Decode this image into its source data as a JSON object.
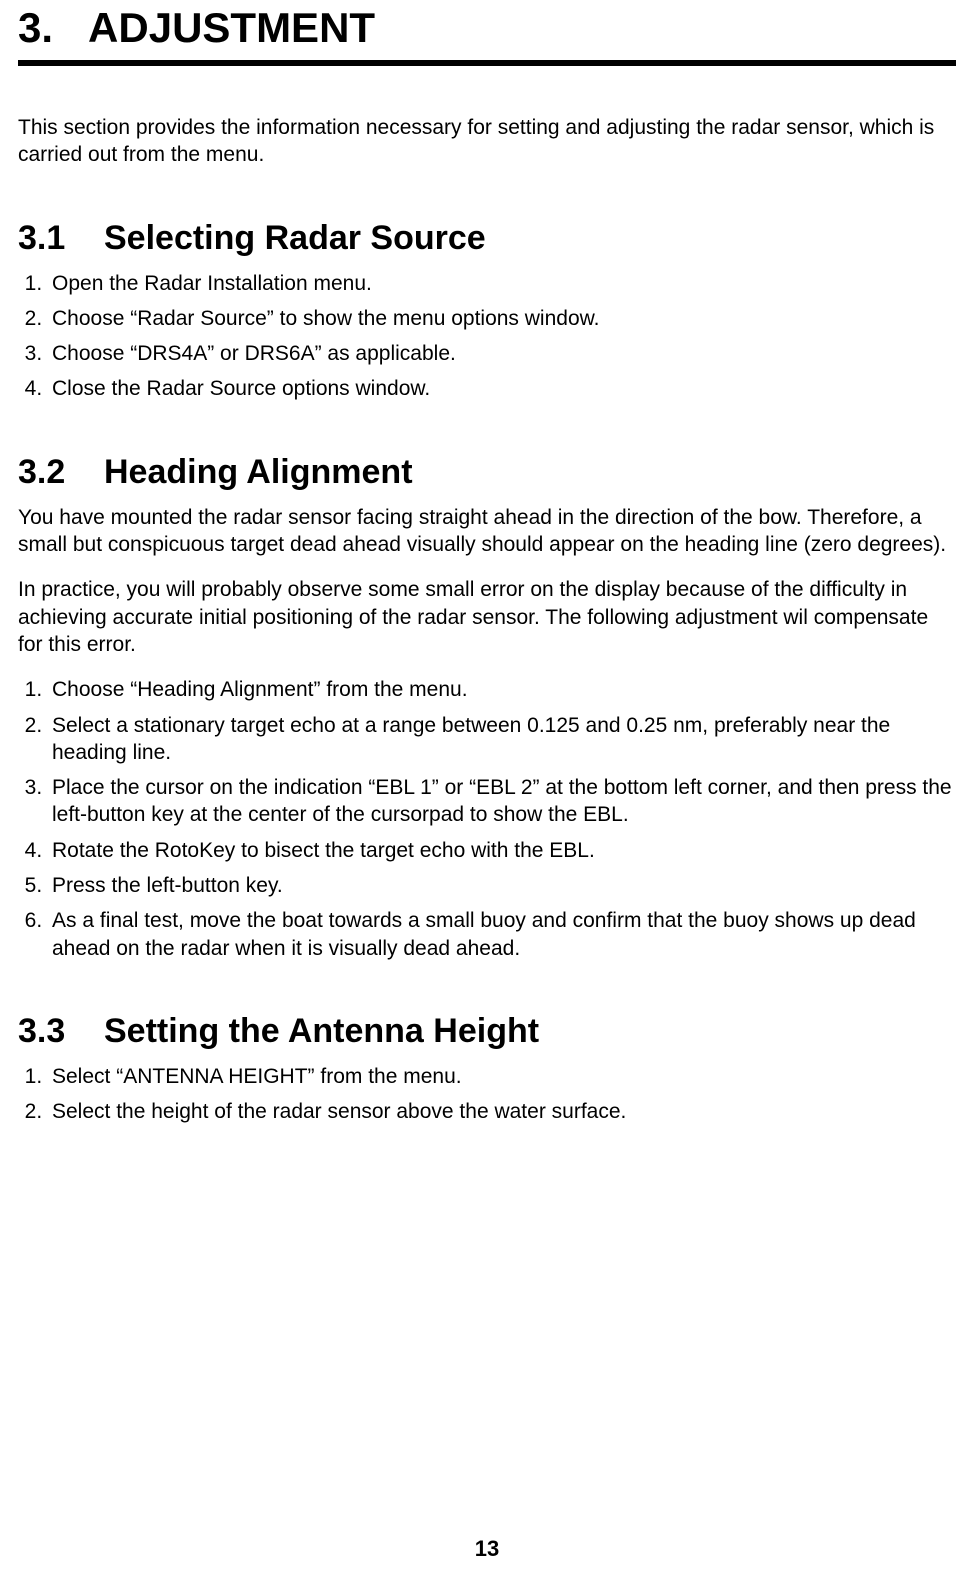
{
  "chapter": {
    "number": "3.",
    "title": "ADJUSTMENT",
    "intro": "This section provides the information necessary for setting and adjusting the radar sensor, which is carried out from the menu."
  },
  "section_3_1": {
    "num": "3.1",
    "title": "Selecting Radar Source",
    "steps": [
      "Open the Radar Installation menu.",
      "Choose “Radar Source” to show the menu options window.",
      "Choose “DRS4A” or DRS6A” as applicable.",
      "Close the Radar Source options window."
    ]
  },
  "section_3_2": {
    "num": "3.2",
    "title": "Heading Alignment",
    "para1": "You have mounted the radar sensor facing straight ahead in the direction of the bow. Therefore, a small but conspicuous target dead ahead visually should appear on the heading line (zero degrees).",
    "para2": "In practice, you will probably observe some small error on the display because of the difficulty in achieving accurate initial positioning of the radar sensor. The following adjustment wil compensate for this error.",
    "steps": [
      "Choose “Heading Alignment” from the menu.",
      "Select a stationary target echo at a range between 0.125 and 0.25 nm, preferably near the heading line.",
      "Place the cursor on the indication  “EBL 1” or “EBL 2” at the bottom left corner, and then press the left-button key at the center of the cursorpad to show the EBL.",
      "Rotate the RotoKey to bisect the target echo with the EBL.",
      "Press the left-button key.",
      "As a final test, move the boat towards a small buoy and confirm that the buoy shows up dead ahead on the radar when it is visually dead ahead."
    ]
  },
  "section_3_3": {
    "num": "3.3",
    "title": "Setting the Antenna Height",
    "steps": [
      "Select “ANTENNA HEIGHT” from the menu.",
      "Select the height of the radar sensor above the water surface."
    ]
  },
  "page_number": "13"
}
